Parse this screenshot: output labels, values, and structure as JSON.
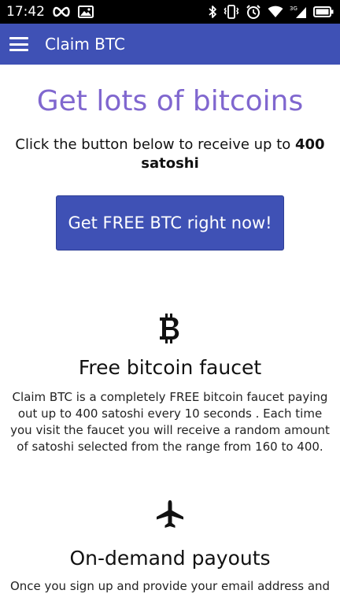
{
  "status_bar": {
    "time": "17:42",
    "left_icons": [
      "infinity-icon",
      "image-icon"
    ],
    "right_icons": [
      "bluetooth-icon",
      "vibrate-icon",
      "alarm-icon",
      "wifi-icon",
      "signal-icon",
      "battery-icon"
    ],
    "signal_label": "3G"
  },
  "app_bar": {
    "title": "Claim BTC",
    "menu_icon": "hamburger-menu-icon",
    "color": "#3f51b5"
  },
  "hero": {
    "headline": "Get lots of bitcoins",
    "headline_color": "#8067cf",
    "intro_text": "Click the button below to receive up to ",
    "intro_amount": "400",
    "intro_unit": "satoshi",
    "button_label": "Get FREE BTC right now!"
  },
  "features": [
    {
      "icon": "bitcoin-icon",
      "title": "Free bitcoin faucet",
      "body": "Claim BTC is a completely FREE bitcoin faucet paying out up to 400 satoshi every 10 seconds . Each time you visit the faucet you will receive a random amount of satoshi selected from the range from 160 to 400."
    },
    {
      "icon": "airplane-icon",
      "title": "On-demand payouts",
      "body": "Once you sign up and provide your email address and"
    }
  ]
}
